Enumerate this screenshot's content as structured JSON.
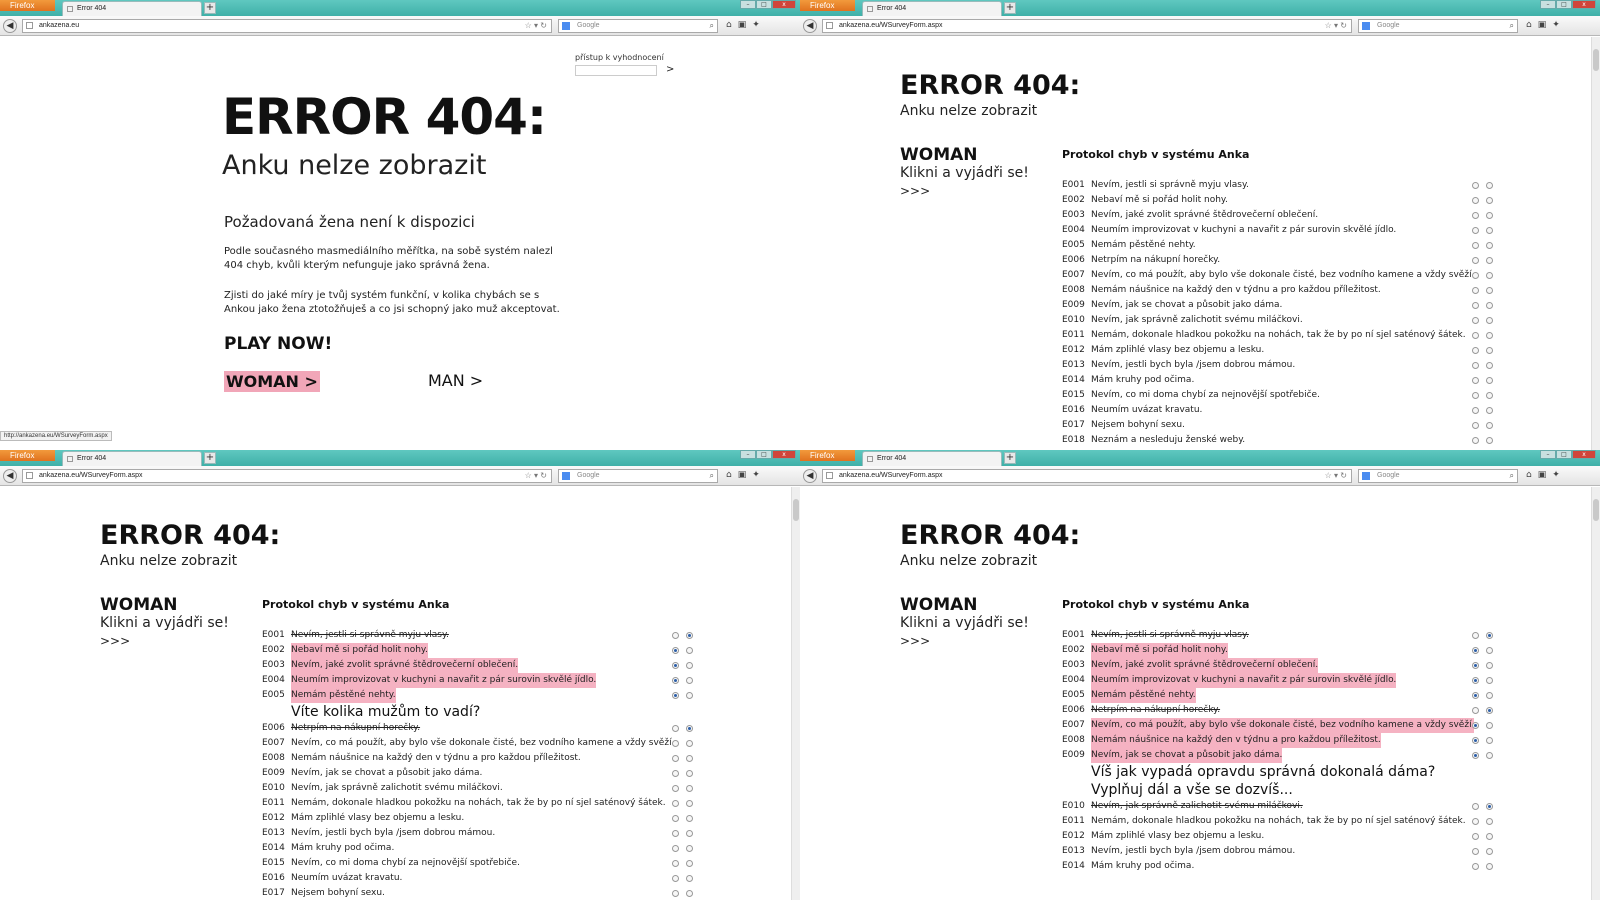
{
  "browser": {
    "app_button": "Firefox",
    "tab_title": "Error 404",
    "new_tab": "+",
    "search_placeholder": "Google",
    "url_home": "ankazena.eu",
    "url_survey": "ankazena.eu/WSurveyForm.aspx",
    "status_url": "http://ankazena.eu/WSurveyForm.aspx",
    "win_min": "–",
    "win_max": "□",
    "win_close": "x"
  },
  "landing": {
    "access_label": "přístup k vyhodnocení",
    "access_go": ">",
    "title": "ERROR 404:",
    "subtitle": "Anku nelze zobrazit",
    "unavailable": "Požadovaná žena není k dispozici",
    "para1": "Podle současného masmediálního měřítka, na sobě systém nalezl 404 chyb, kvůli kterým nefunguje jako správná žena.",
    "para2": "Zjisti do jaké míry je tvůj systém funkční, v kolika chybách se s Ankou jako žena ztotožňuješ a co jsi schopný jako muž akceptovat.",
    "play": "PLAY NOW!",
    "woman": "WOMAN >",
    "man": "MAN >"
  },
  "survey": {
    "title": "ERROR 404:",
    "subtitle": "Anku nelze zobrazit",
    "woman": "WOMAN",
    "klikni": "Klikni a vyjádři se!",
    "arrows": ">>>",
    "protocol": "Protokol chyb v systému Anka",
    "q1": "Víte kolika mužům to vadí?",
    "q2a": "Víš jak vypadá opravdu správná dokonalá dáma?",
    "q2b": "Vyplňuj dál a vše se dozvíš..."
  },
  "errors": [
    {
      "code": "E001",
      "text": "Nevím, jestli si správně myju vlasy."
    },
    {
      "code": "E002",
      "text": "Nebaví mě si pořád holit nohy."
    },
    {
      "code": "E003",
      "text": "Nevím, jaké zvolit správné štědrovečerní oblečení."
    },
    {
      "code": "E004",
      "text": "Neumím improvizovat v kuchyni a navařit z pár surovin skvělé jídlo."
    },
    {
      "code": "E005",
      "text": "Nemám pěstěné nehty."
    },
    {
      "code": "E006",
      "text": "Netrpím na nákupní horečky."
    },
    {
      "code": "E007",
      "text": "Nevím, co má použít, aby bylo vše dokonale čisté, bez vodního kamene a vždy svěží."
    },
    {
      "code": "E008",
      "text": "Nemám náušnice na každý den v týdnu a pro každou příležitost."
    },
    {
      "code": "E009",
      "text": "Nevím, jak se chovat a působit jako dáma."
    },
    {
      "code": "E010",
      "text": "Nevím, jak správně zalichotit svému miláčkovi."
    },
    {
      "code": "E011",
      "text": "Nemám, dokonale hladkou pokožku na nohách, tak že by po ní sjel saténový šátek."
    },
    {
      "code": "E012",
      "text": "Mám zplihlé vlasy bez objemu a lesku."
    },
    {
      "code": "E013",
      "text": "Nevím, jestli bych byla /jsem dobrou mámou."
    },
    {
      "code": "E014",
      "text": "Mám kruhy pod očima."
    },
    {
      "code": "E015",
      "text": "Nevím, co mi doma chybí za nejnovější spotřebiče."
    },
    {
      "code": "E016",
      "text": "Neumím uvázat kravatu."
    },
    {
      "code": "E017",
      "text": "Nejsem bohyní sexu."
    },
    {
      "code": "E018",
      "text": "Neznám a nesleduju ženské weby."
    }
  ],
  "panels": {
    "q2": {
      "answers": {}
    },
    "q3": {
      "answers": {
        "0": 2,
        "1": 1,
        "2": 1,
        "3": 1,
        "4": 1,
        "5": 2
      },
      "question_after": 4,
      "question_key": "q1",
      "visible_rows": 17
    },
    "q4": {
      "answers": {
        "0": 2,
        "1": 1,
        "2": 1,
        "3": 1,
        "4": 1,
        "5": 2,
        "6": 1,
        "7": 1,
        "8": 1,
        "9": 2
      },
      "question_after": 8,
      "question_key": "q2",
      "visible_rows": 14
    }
  }
}
